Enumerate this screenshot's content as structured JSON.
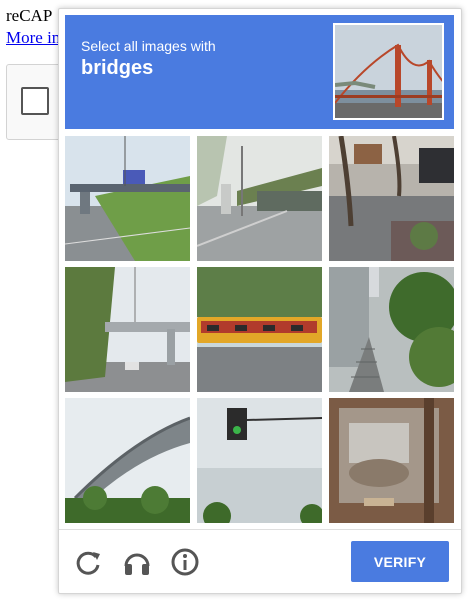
{
  "background": {
    "title": "reCAP",
    "link": "More in"
  },
  "challenge": {
    "instruction": "Select all images with",
    "object": "bridges",
    "sample_image": "golden-gate-bridge"
  },
  "tiles": [
    {
      "id": 1,
      "scene": "highway overpass with truck"
    },
    {
      "id": 2,
      "scene": "road underpass"
    },
    {
      "id": 3,
      "scene": "street with parked cars"
    },
    {
      "id": 4,
      "scene": "overpass over road"
    },
    {
      "id": 5,
      "scene": "yellow tram"
    },
    {
      "id": 6,
      "scene": "stairs with bushes"
    },
    {
      "id": 7,
      "scene": "curved highway bridge"
    },
    {
      "id": 8,
      "scene": "traffic light and sky"
    },
    {
      "id": 9,
      "scene": "cafe window reflection"
    }
  ],
  "footer": {
    "reload_icon": "reload-icon",
    "audio_icon": "headphones-icon",
    "info_icon": "info-icon",
    "verify_label": "VERIFY"
  },
  "colors": {
    "accent": "#4a7be0"
  }
}
